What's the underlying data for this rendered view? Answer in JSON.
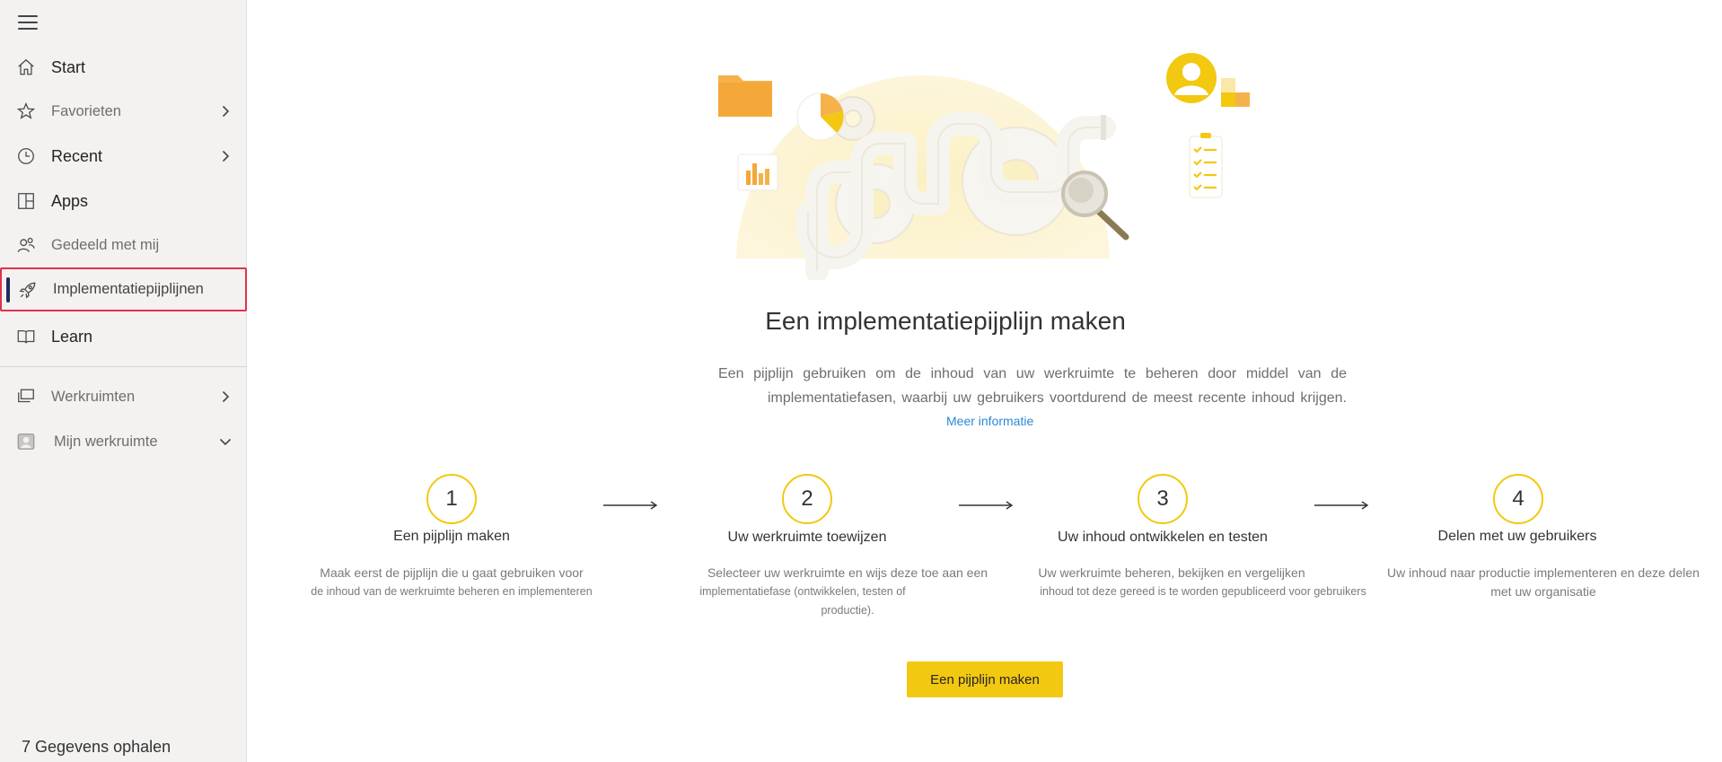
{
  "sidebar": {
    "items": [
      {
        "label": "Start",
        "icon": "home-icon"
      },
      {
        "label": "Favorieten",
        "icon": "star-icon"
      },
      {
        "label": "Recent",
        "icon": "clock-icon"
      },
      {
        "label": "Apps",
        "icon": "apps-icon"
      },
      {
        "label": "Gedeeld met mij",
        "icon": "shared-people-icon"
      },
      {
        "label": "Implementatiepijplijnen",
        "icon": "rocket-icon"
      },
      {
        "label": "Learn",
        "icon": "book-icon"
      },
      {
        "label": "Werkruimten",
        "icon": "workspaces-icon"
      },
      {
        "label": "Mijn werkruimte",
        "icon": "my-workspace-icon"
      }
    ],
    "footer_label": "7 Gegevens ophalen"
  },
  "main": {
    "title": "Een implementatiepijplijn maken",
    "description_line1": "Een pijplijn gebruiken om de inhoud van uw werkruimte te beheren door middel van de",
    "description_line2": "implementatiefasen, waarbij uw gebruikers voortdurend de meest recente inhoud krijgen.",
    "more_link": "Meer informatie",
    "steps": [
      {
        "number": "1",
        "title": "Een pijplijn maken",
        "line1": "Maak eerst de pijplijn die u gaat gebruiken voor",
        "line2": "de inhoud van de werkruimte beheren en implementeren",
        "line3": ""
      },
      {
        "number": "2",
        "title": "Uw werkruimte toewijzen",
        "line1": "Selecteer uw werkruimte en wijs deze toe aan een",
        "line2": "implementatiefase (ontwikkelen, testen of",
        "line3": "productie)."
      },
      {
        "number": "3",
        "title": "Uw inhoud ontwikkelen en testen",
        "line1": "Uw werkruimte beheren, bekijken en vergelijken",
        "line2": "inhoud tot deze gereed is te worden gepubliceerd voor gebruikers",
        "line3": ""
      },
      {
        "number": "4",
        "title": "Delen met uw gebruikers",
        "line1": "Uw inhoud naar productie implementeren en deze delen",
        "line2": "met uw organisatie",
        "line3": ""
      }
    ],
    "cta_label": "Een pijplijn maken"
  },
  "colors": {
    "accent": "#f2c811",
    "link": "#2b88d8",
    "selected_border": "#e0314b",
    "selected_bar": "#1f2a5c"
  }
}
